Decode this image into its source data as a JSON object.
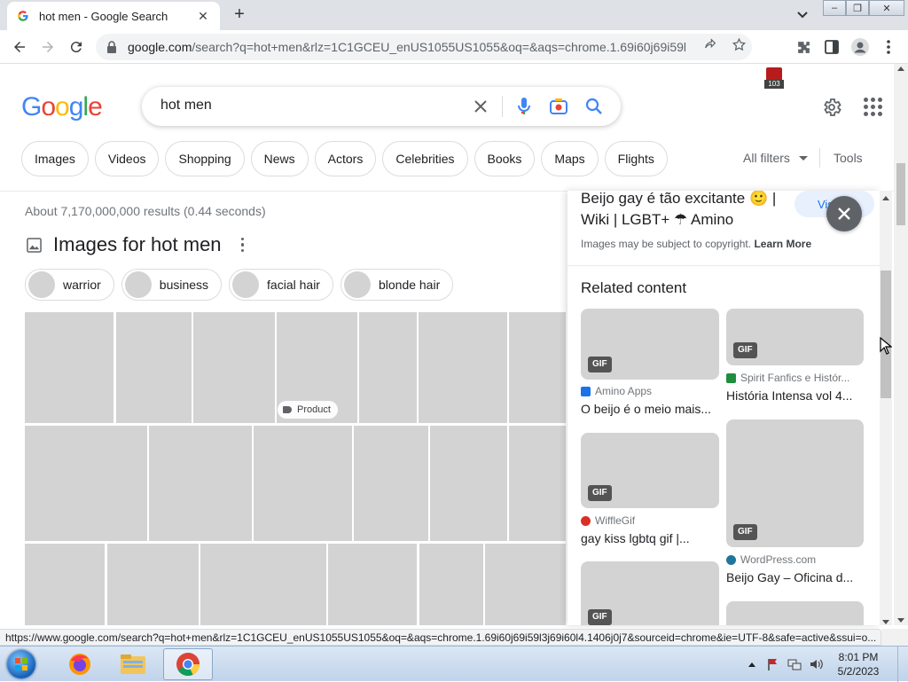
{
  "browser": {
    "tab_title": "hot men - Google Search",
    "url_host": "google.com",
    "url_path": "/search?q=hot+men&rlz=1C1GCEU_enUS1055US1055&oq=&aqs=chrome.1.69i60j69i59l...",
    "extension_badge": "103"
  },
  "google": {
    "logo_letters": [
      "G",
      "o",
      "o",
      "g",
      "l",
      "e"
    ],
    "logo_colors": [
      "#4285F4",
      "#EA4335",
      "#FBBC05",
      "#4285F4",
      "#34A853",
      "#EA4335"
    ],
    "query": "hot men",
    "chips": [
      "Images",
      "Videos",
      "Shopping",
      "News",
      "Actors",
      "Celebrities",
      "Books",
      "Maps",
      "Flights"
    ],
    "all_filters": "All filters",
    "tools": "Tools"
  },
  "results": {
    "stats": "About 7,170,000,000 results (0.44 seconds)",
    "images_title": "Images for hot men",
    "refinements": [
      "warrior",
      "business",
      "facial hair",
      "blonde hair"
    ],
    "product_badge": "Product"
  },
  "panel": {
    "title": "Beijo gay é tão excitante 🙂 | Wiki | LGBT+ ☂ Amino",
    "visit": "Visit",
    "copyright_text": "Images may be subject to copyright.",
    "learn_more": "Learn More",
    "related_heading": "Related content",
    "gif_label": "GIF",
    "items": [
      {
        "source": "Amino Apps",
        "title": "O beijo é o meio mais..."
      },
      {
        "source": "Spirit Fanfics e Histór...",
        "title": "História Intensa vol 4..."
      },
      {
        "source": "WiffleGif",
        "title": "gay kiss lgbtq gif |..."
      },
      {
        "source": "WordPress.com",
        "title": "Beijo Gay – Oficina d..."
      }
    ]
  },
  "status_url": "https://www.google.com/search?q=hot+men&rlz=1C1GCEU_enUS1055US1055&oq=&aqs=chrome.1.69i60j69i59l3j69i60l4.1406j0j7&sourceid=chrome&ie=UTF-8&safe=active&ssui=o...",
  "taskbar": {
    "time": "8:01 PM",
    "date": "5/2/2023"
  }
}
